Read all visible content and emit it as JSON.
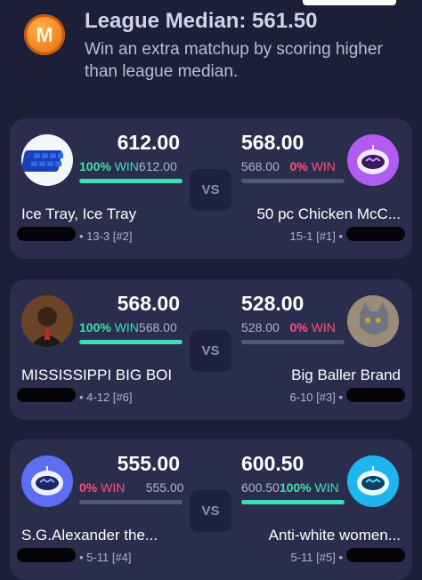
{
  "median": {
    "badge_letter": "M",
    "title": "League Median: 561.50",
    "description": "Win an extra matchup by scoring higher than league median."
  },
  "vs_label": "VS",
  "matchups": [
    {
      "left": {
        "score": "612.00",
        "pct": "100%",
        "win": "WIN",
        "proj": "612.00",
        "bar": 1.0,
        "team": "Ice Tray, Ice Tray",
        "record": "• 13-3 [#2]",
        "avatar": "ice-tray-photo"
      },
      "right": {
        "score": "568.00",
        "pct": "0%",
        "win": "WIN",
        "proj": "568.00",
        "bar": 0.0,
        "team": "50 pc Chicken McC...",
        "record": "15-1 [#1] •",
        "avatar": "robot-purple"
      }
    },
    {
      "left": {
        "score": "568.00",
        "pct": "100%",
        "win": "WIN",
        "proj": "568.00",
        "bar": 1.0,
        "team": "MISSISSIPPI BIG BOI",
        "record": "• 4-12 [#6]",
        "avatar": "person-photo"
      },
      "right": {
        "score": "528.00",
        "pct": "0%",
        "win": "WIN",
        "proj": "528.00",
        "bar": 0.0,
        "team": "Big Baller Brand",
        "record": "6-10 [#3] •",
        "avatar": "cat-photo"
      }
    },
    {
      "left": {
        "score": "555.00",
        "pct": "0%",
        "win": "WIN",
        "proj": "555.00",
        "bar": 0.0,
        "team": "S.G.Alexander the...",
        "record": "• 5-11 [#4]",
        "avatar": "robot-blue"
      },
      "right": {
        "score": "600.50",
        "pct": "100%",
        "win": "WIN",
        "proj": "600.50",
        "bar": 1.0,
        "team": "Anti-white women...",
        "record": "5-11 [#5] •",
        "avatar": "robot-cyan"
      }
    }
  ],
  "colors": {
    "win_green": "#3ee0b3",
    "lose_red": "#ff4f7b",
    "median_orange": "#f07b1a"
  }
}
